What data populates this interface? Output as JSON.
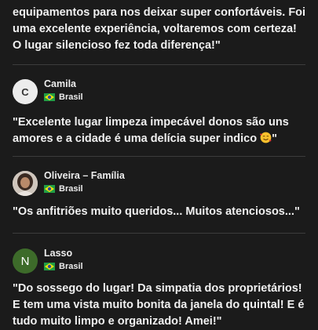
{
  "reviews": [
    {
      "text": "equipamentos para nos deixar super confortáveis. Foi uma excelente experiência, voltaremos com certeza! O lugar silencioso fez toda diferença!\""
    },
    {
      "name": "Camila",
      "avatar_letter": "C",
      "country": "Brasil",
      "text": "\"Excelente lugar limpeza impecável donos são uns amores e a cidade é uma delícia super indico ",
      "text_end": "\""
    },
    {
      "name": "Oliveira – Família",
      "country": "Brasil",
      "text": "\"Os anfitriões muito queridos... Muitos atenciosos...\""
    },
    {
      "name": "Lasso",
      "avatar_letter": "N",
      "country": "Brasil",
      "text": "\"Do sossego do lugar! Da simpatia dos proprietários! E tem uma vista muito bonita da janela do quintal! E é tudo muito limpo e organizado! Amei!\""
    }
  ],
  "colors": {
    "background": "#1b1b1b",
    "text": "#ececec",
    "divider": "#3c3c3c",
    "avatar_light": "#ececec",
    "avatar_green": "#3d6b2a"
  },
  "icons": [
    "brazil-flag-icon",
    "smiling-face-with-hearts-emoji"
  ]
}
